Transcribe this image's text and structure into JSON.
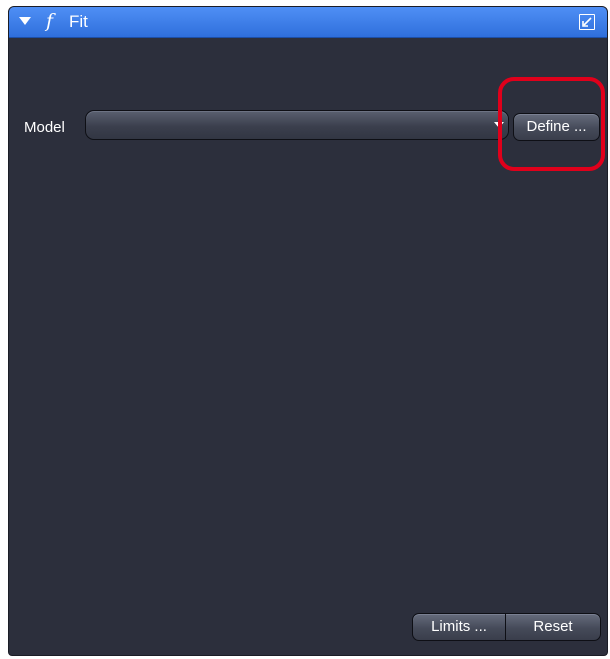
{
  "panel": {
    "title": "Fit",
    "func_symbol": "f",
    "header_color": "#3a7ef0",
    "background_color": "#2c2f3c"
  },
  "model": {
    "label": "Model",
    "selected_value": "",
    "define_label": "Define ..."
  },
  "footer": {
    "limits_label": "Limits ...",
    "reset_label": "Reset"
  },
  "annotation": {
    "highlight_color": "#e0001b"
  }
}
